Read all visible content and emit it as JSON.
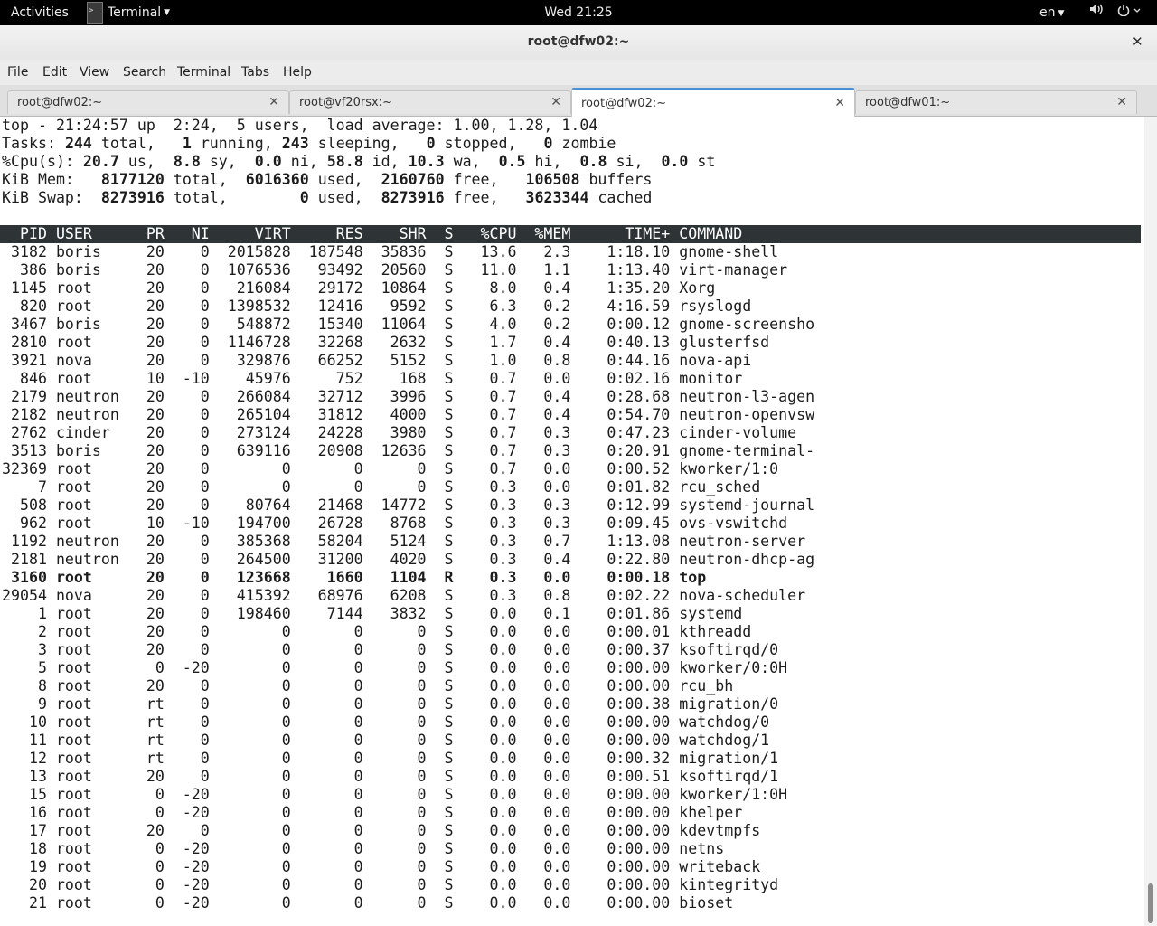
{
  "topbar": {
    "activities": "Activities",
    "app_name": "Terminal",
    "clock": "Wed 21:25",
    "lang": "en"
  },
  "window": {
    "title": "root@dfw02:~",
    "close_glyph": "✕"
  },
  "menubar": {
    "items": [
      "File",
      "Edit",
      "View",
      "Search",
      "Terminal",
      "Tabs",
      "Help"
    ]
  },
  "tabs": [
    {
      "label": "root@dfw02:~",
      "active": false
    },
    {
      "label": "root@vf20rsx:~",
      "active": false
    },
    {
      "label": "root@dfw02:~",
      "active": true
    },
    {
      "label": "root@dfw01:~",
      "active": false
    }
  ],
  "icons": {
    "app": "terminal-icon",
    "volume": "volume-icon",
    "power": "power-icon",
    "tab_close": "close-icon",
    "window_close": "close-icon"
  },
  "summary": {
    "uptime_line": "top - 21:24:57 up  2:24,  5 users,  load average: 1.00, 1.28, 1.04",
    "tasks": {
      "total": "244",
      "running": "1",
      "sleeping": "243",
      "stopped": "0",
      "zombie": "0"
    },
    "cpu": {
      "us": "20.7",
      "sy": "8.8",
      "ni": "0.0",
      "id": "58.8",
      "wa": "10.3",
      "hi": "0.5",
      "si": "0.8",
      "st": "0.0"
    },
    "mem": {
      "total": "8177120",
      "used": "6016360",
      "free": "2160760",
      "buffers": "106508"
    },
    "swap": {
      "total": "8273916",
      "used": "0",
      "free": "8273916",
      "cached": "3623344"
    }
  },
  "columns": [
    "PID",
    "USER",
    "PR",
    "NI",
    "VIRT",
    "RES",
    "SHR",
    "S",
    "%CPU",
    "%MEM",
    "TIME+",
    "COMMAND"
  ],
  "processes": [
    [
      "3182",
      "boris",
      "20",
      "0",
      "2015828",
      "187548",
      "35836",
      "S",
      "13.6",
      "2.3",
      "1:18.10",
      "gnome-shell"
    ],
    [
      "386",
      "boris",
      "20",
      "0",
      "1076536",
      "93492",
      "20560",
      "S",
      "11.0",
      "1.1",
      "1:13.40",
      "virt-manager"
    ],
    [
      "1145",
      "root",
      "20",
      "0",
      "216084",
      "29172",
      "10864",
      "S",
      "8.0",
      "0.4",
      "1:35.20",
      "Xorg"
    ],
    [
      "820",
      "root",
      "20",
      "0",
      "1398532",
      "12416",
      "9592",
      "S",
      "6.3",
      "0.2",
      "4:16.59",
      "rsyslogd"
    ],
    [
      "3467",
      "boris",
      "20",
      "0",
      "548872",
      "15340",
      "11064",
      "S",
      "4.0",
      "0.2",
      "0:00.12",
      "gnome-screensho"
    ],
    [
      "2810",
      "root",
      "20",
      "0",
      "1146728",
      "32268",
      "2632",
      "S",
      "1.7",
      "0.4",
      "0:40.13",
      "glusterfsd"
    ],
    [
      "3921",
      "nova",
      "20",
      "0",
      "329876",
      "66252",
      "5152",
      "S",
      "1.0",
      "0.8",
      "0:44.16",
      "nova-api"
    ],
    [
      "846",
      "root",
      "10",
      "-10",
      "45976",
      "752",
      "168",
      "S",
      "0.7",
      "0.0",
      "0:02.16",
      "monitor"
    ],
    [
      "2179",
      "neutron",
      "20",
      "0",
      "266084",
      "32712",
      "3996",
      "S",
      "0.7",
      "0.4",
      "0:28.68",
      "neutron-l3-agen"
    ],
    [
      "2182",
      "neutron",
      "20",
      "0",
      "265104",
      "31812",
      "4000",
      "S",
      "0.7",
      "0.4",
      "0:54.70",
      "neutron-openvsw"
    ],
    [
      "2762",
      "cinder",
      "20",
      "0",
      "273124",
      "24228",
      "3980",
      "S",
      "0.7",
      "0.3",
      "0:47.23",
      "cinder-volume"
    ],
    [
      "3513",
      "boris",
      "20",
      "0",
      "639116",
      "20908",
      "12636",
      "S",
      "0.7",
      "0.3",
      "0:20.91",
      "gnome-terminal-"
    ],
    [
      "32369",
      "root",
      "20",
      "0",
      "0",
      "0",
      "0",
      "S",
      "0.7",
      "0.0",
      "0:00.52",
      "kworker/1:0"
    ],
    [
      "7",
      "root",
      "20",
      "0",
      "0",
      "0",
      "0",
      "S",
      "0.3",
      "0.0",
      "0:01.82",
      "rcu_sched"
    ],
    [
      "508",
      "root",
      "20",
      "0",
      "80764",
      "21468",
      "14772",
      "S",
      "0.3",
      "0.3",
      "0:12.99",
      "systemd-journal"
    ],
    [
      "962",
      "root",
      "10",
      "-10",
      "194700",
      "26728",
      "8768",
      "S",
      "0.3",
      "0.3",
      "0:09.45",
      "ovs-vswitchd"
    ],
    [
      "1192",
      "neutron",
      "20",
      "0",
      "385368",
      "58204",
      "5124",
      "S",
      "0.3",
      "0.7",
      "1:13.08",
      "neutron-server"
    ],
    [
      "2181",
      "neutron",
      "20",
      "0",
      "264500",
      "31200",
      "4020",
      "S",
      "0.3",
      "0.4",
      "0:22.80",
      "neutron-dhcp-ag"
    ],
    [
      "3160",
      "root",
      "20",
      "0",
      "123668",
      "1660",
      "1104",
      "R",
      "0.3",
      "0.0",
      "0:00.18",
      "top"
    ],
    [
      "29054",
      "nova",
      "20",
      "0",
      "415392",
      "68976",
      "6208",
      "S",
      "0.3",
      "0.8",
      "0:02.22",
      "nova-scheduler"
    ],
    [
      "1",
      "root",
      "20",
      "0",
      "198460",
      "7144",
      "3832",
      "S",
      "0.0",
      "0.1",
      "0:01.86",
      "systemd"
    ],
    [
      "2",
      "root",
      "20",
      "0",
      "0",
      "0",
      "0",
      "S",
      "0.0",
      "0.0",
      "0:00.01",
      "kthreadd"
    ],
    [
      "3",
      "root",
      "20",
      "0",
      "0",
      "0",
      "0",
      "S",
      "0.0",
      "0.0",
      "0:00.37",
      "ksoftirqd/0"
    ],
    [
      "5",
      "root",
      "0",
      "-20",
      "0",
      "0",
      "0",
      "S",
      "0.0",
      "0.0",
      "0:00.00",
      "kworker/0:0H"
    ],
    [
      "8",
      "root",
      "20",
      "0",
      "0",
      "0",
      "0",
      "S",
      "0.0",
      "0.0",
      "0:00.00",
      "rcu_bh"
    ],
    [
      "9",
      "root",
      "rt",
      "0",
      "0",
      "0",
      "0",
      "S",
      "0.0",
      "0.0",
      "0:00.38",
      "migration/0"
    ],
    [
      "10",
      "root",
      "rt",
      "0",
      "0",
      "0",
      "0",
      "S",
      "0.0",
      "0.0",
      "0:00.00",
      "watchdog/0"
    ],
    [
      "11",
      "root",
      "rt",
      "0",
      "0",
      "0",
      "0",
      "S",
      "0.0",
      "0.0",
      "0:00.00",
      "watchdog/1"
    ],
    [
      "12",
      "root",
      "rt",
      "0",
      "0",
      "0",
      "0",
      "S",
      "0.0",
      "0.0",
      "0:00.32",
      "migration/1"
    ],
    [
      "13",
      "root",
      "20",
      "0",
      "0",
      "0",
      "0",
      "S",
      "0.0",
      "0.0",
      "0:00.51",
      "ksoftirqd/1"
    ],
    [
      "15",
      "root",
      "0",
      "-20",
      "0",
      "0",
      "0",
      "S",
      "0.0",
      "0.0",
      "0:00.00",
      "kworker/1:0H"
    ],
    [
      "16",
      "root",
      "0",
      "-20",
      "0",
      "0",
      "0",
      "S",
      "0.0",
      "0.0",
      "0:00.00",
      "khelper"
    ],
    [
      "17",
      "root",
      "20",
      "0",
      "0",
      "0",
      "0",
      "S",
      "0.0",
      "0.0",
      "0:00.00",
      "kdevtmpfs"
    ],
    [
      "18",
      "root",
      "0",
      "-20",
      "0",
      "0",
      "0",
      "S",
      "0.0",
      "0.0",
      "0:00.00",
      "netns"
    ],
    [
      "19",
      "root",
      "0",
      "-20",
      "0",
      "0",
      "0",
      "S",
      "0.0",
      "0.0",
      "0:00.00",
      "writeback"
    ],
    [
      "20",
      "root",
      "0",
      "-20",
      "0",
      "0",
      "0",
      "S",
      "0.0",
      "0.0",
      "0:00.00",
      "kintegrityd"
    ],
    [
      "21",
      "root",
      "0",
      "-20",
      "0",
      "0",
      "0",
      "S",
      "0.0",
      "0.0",
      "0:00.00",
      "bioset"
    ]
  ],
  "highlight_pid": "3160"
}
